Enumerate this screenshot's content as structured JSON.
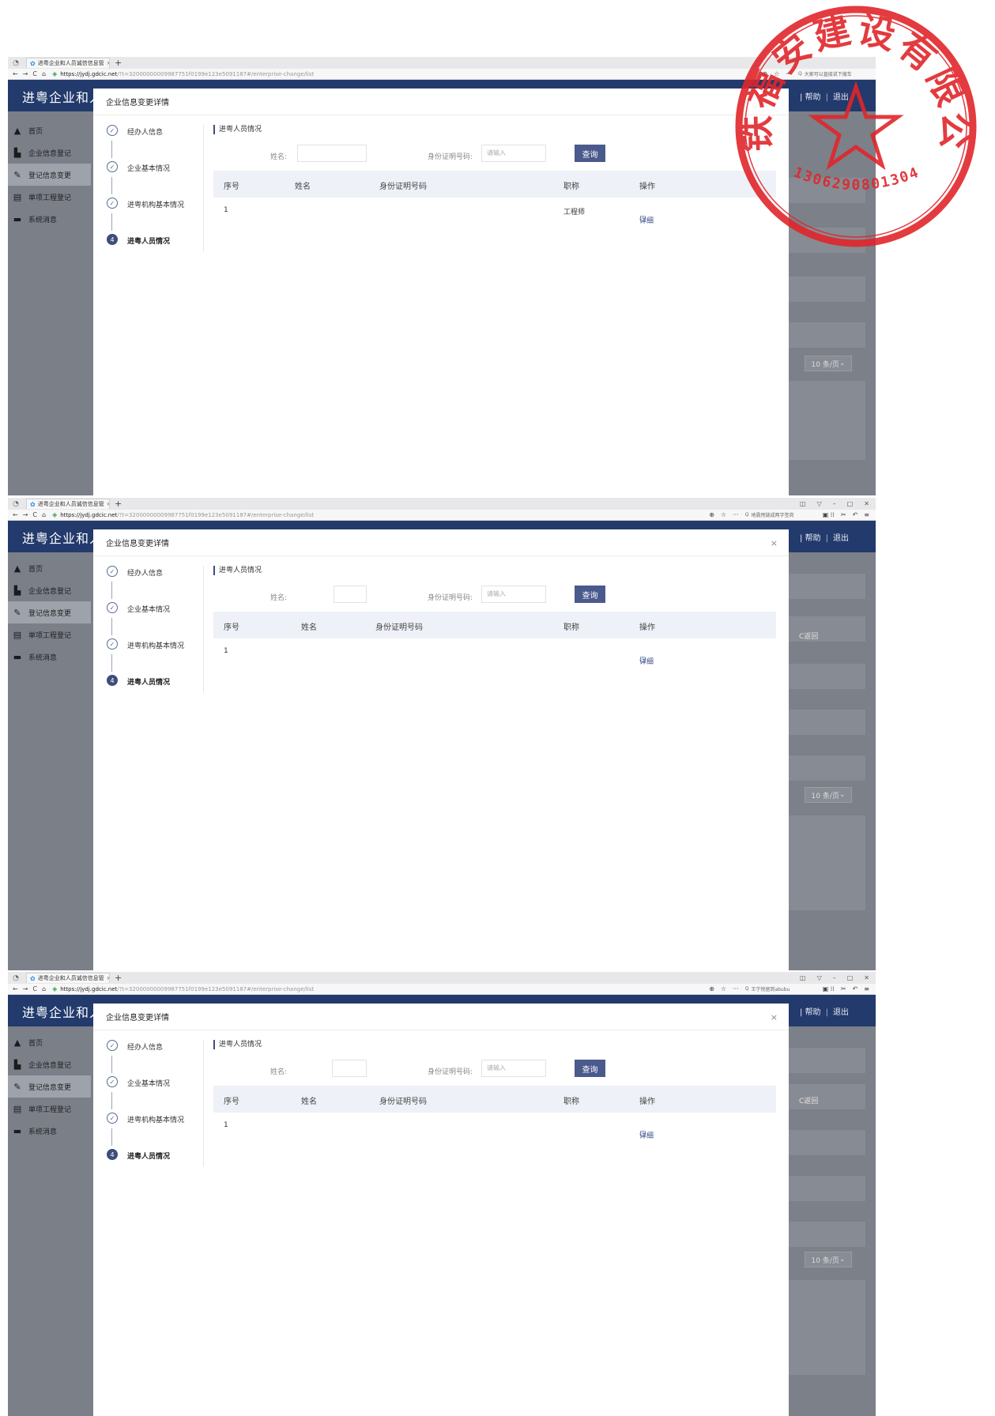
{
  "browser": {
    "tab_title": "进粤企业和人员诚信信息管",
    "tab_close": "×",
    "new_tab": "+",
    "url_host": "https://jydj.gdcic.net",
    "url_rest": "/?t=32000000009987751f0199e123e5091187#/enterprise-change/list",
    "url_dots": "···",
    "search_texts": [
      "大家可以直接说下搜车",
      "地震甩链成两字签岗",
      "王宁悦居到abubu"
    ]
  },
  "app": {
    "brand": "进粤企业和人",
    "help": "帮助",
    "sep": "|",
    "logout": "退出",
    "back": "C返回",
    "per_page": "10 条/页",
    "sidebar": [
      "首页",
      "企业信息登记",
      "登记信息变更",
      "单项工程登记",
      "系统消息"
    ]
  },
  "modal": {
    "title": "企业信息变更详情",
    "close": "×",
    "steps": [
      {
        "label": "经办人信息",
        "mark": "✓"
      },
      {
        "label": "企业基本情况",
        "mark": "✓"
      },
      {
        "label": "进粤机构基本情况",
        "mark": "✓"
      },
      {
        "label": "进粤人员情况",
        "mark": "4"
      }
    ],
    "section_title": "进粤人员情况",
    "name_label": "姓名:",
    "id_label": "身份证明号码:",
    "id_placeholder": "请输入",
    "query_button": "查询",
    "columns": [
      "序号",
      "姓名",
      "身份证明号码",
      "职称",
      "操作"
    ],
    "rows": [
      {
        "index": "1",
        "title": "工程师",
        "action": "详细"
      },
      {
        "index": "1",
        "title": "",
        "action": "详细"
      },
      {
        "index": "1",
        "title": "",
        "action": "详细"
      }
    ]
  },
  "stamp": {
    "company_name": "中铁福安建设有限公司",
    "number": "1306290801304",
    "color": "#e0262b"
  }
}
